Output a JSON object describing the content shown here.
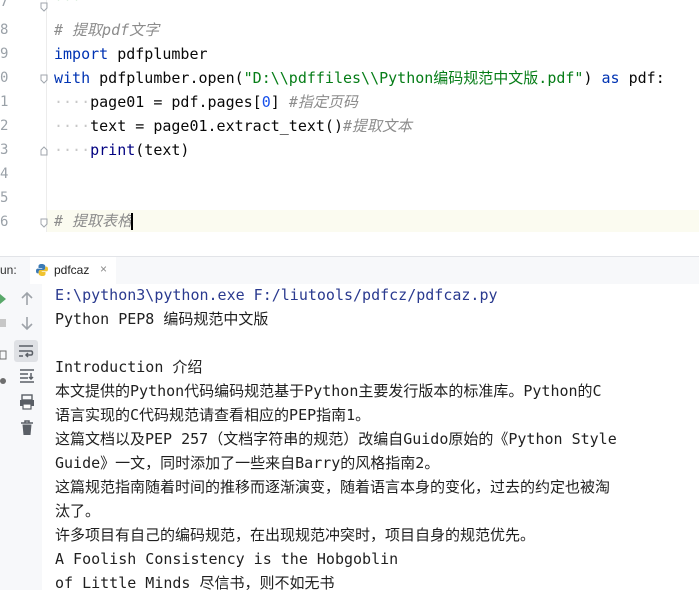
{
  "editor": {
    "line_numbers": [
      "7",
      "8",
      "9",
      "0",
      "1",
      "2",
      "3",
      "4",
      "5",
      "6"
    ],
    "line1": "'''",
    "comment1": "# 提取pdf文字",
    "import_kw": "import",
    "import_rest": " pdfplumber",
    "with_kw": "with",
    "with_call": " pdfplumber.open(",
    "with_path": "\"D:\\\\pdffiles\\\\Python编码规范中文版.pdf\"",
    "with_close": ")",
    "as_kw": " as ",
    "as_rest": "pdf:",
    "indent": "····",
    "page_assign": "page01 = pdf.pages[",
    "page_index": "0",
    "page_close": "] ",
    "page_comment": "#指定页码",
    "text_assign": "text = page01.extract_text()",
    "text_comment": "#提取文本",
    "print_kw": "print",
    "print_rest": "(text)",
    "comment2": "# 提取表格"
  },
  "run_panel": {
    "label": "un:",
    "tab_label": "pdfcaz",
    "close_glyph": "×"
  },
  "console": {
    "lines": [
      "E:\\python3\\python.exe F:/liutools/pdfcz/pdfcaz.py",
      "Python PEP8 编码规范中文版",
      "",
      "Introduction 介绍",
      "本文提供的Python代码编码规范基于Python主要发行版本的标准库。Python的C",
      "语言实现的C代码规范请查看相应的PEP指南1。",
      "这篇文档以及PEP 257（文档字符串的规范）改编自Guido原始的《Python Style",
      "Guide》一文，同时添加了一些来自Barry的风格指南2。",
      "这篇规范指南随着时间的推移而逐渐演变，随着语言本身的变化，过去的约定也被淘",
      "汰了。",
      "许多项目有自己的编码规范，在出现规范冲突时，项目自身的规范优先。",
      "A Foolish Consistency is the Hobgoblin",
      "of Little Minds 尽信书，则不如无书"
    ]
  },
  "colors": {
    "keyword": "#0033b3",
    "string": "#067d17",
    "comment": "#8c8c8c",
    "number": "#1750eb",
    "accent": "#3574f0"
  }
}
